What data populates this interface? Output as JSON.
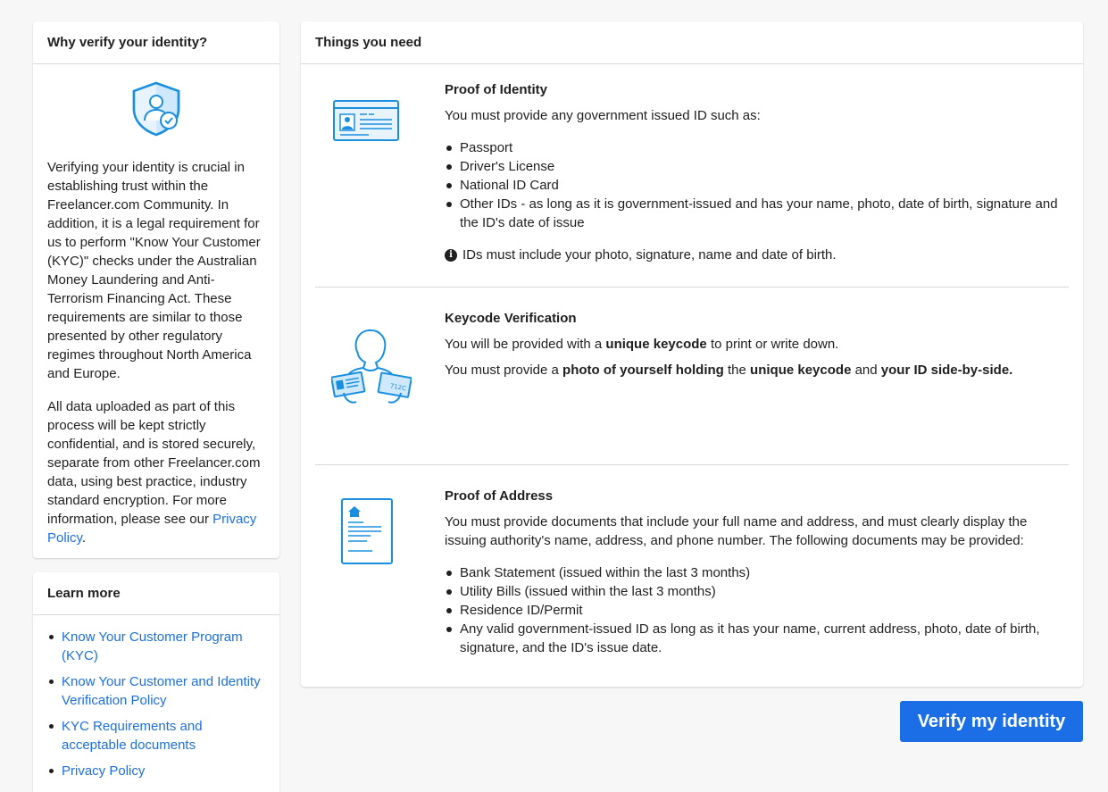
{
  "why": {
    "title": "Why verify your identity?",
    "p1": "Verifying your identity is crucial in establishing trust within the Freelancer.com Community. In addition, it is a legal requirement for us to perform \"Know Your Customer (KYC)\" checks under the Australian Money Laundering and Anti-Terrorism Financing Act. These requirements are similar to those presented by other regulatory regimes throughout North America and Europe.",
    "p2_text": "All data uploaded as part of this process will be kept strictly confidential, and is stored securely, separate from other Freelancer.com data, using best practice, industry standard encryption. For more information, please see our",
    "p2_link": "Privacy Policy",
    "p2_end": "."
  },
  "learn": {
    "title": "Learn more",
    "links": [
      "Know Your Customer Program (KYC)",
      "Know Your Customer and Identity Verification Policy",
      "KYC Requirements and acceptable documents",
      "Privacy Policy"
    ]
  },
  "things": {
    "title": "Things you need",
    "identity": {
      "title": "Proof of Identity",
      "intro": "You must provide any government issued ID such as:",
      "items": [
        "Passport",
        "Driver's License",
        "National ID Card",
        "Other IDs - as long as it is government-issued and has your name, photo, date of birth, signature and the ID's date of issue"
      ],
      "note": "IDs must include your photo, signature, name and date of birth."
    },
    "keycode": {
      "title": "Keycode Verification",
      "l1_a": "You will be provided with a",
      "l1_b": "unique keycode",
      "l1_c": "to print or write down.",
      "l2_a": "You must provide a",
      "l2_b": "photo of yourself holding",
      "l2_c": "the",
      "l2_d": "unique keycode",
      "l2_e": "and",
      "l2_f": "your ID side-by-side.",
      "card_code": "712C"
    },
    "address": {
      "title": "Proof of Address",
      "intro": "You must provide documents that include your full name and address, and must clearly display the issuing authority's name, address, and phone number. The following documents may be provided:",
      "items": [
        "Bank Statement (issued within the last 3 months)",
        "Utility Bills (issued within the last 3 months)",
        "Residence ID/Permit",
        "Any valid government-issued ID as long as it has your name, current address, photo, date of birth, signature, and the ID's issue date."
      ]
    }
  },
  "verify_button": "Verify my identity",
  "colors": {
    "accent": "#1c6ee6",
    "link": "#1d6fe0",
    "illustration": "#1a8fe0"
  }
}
